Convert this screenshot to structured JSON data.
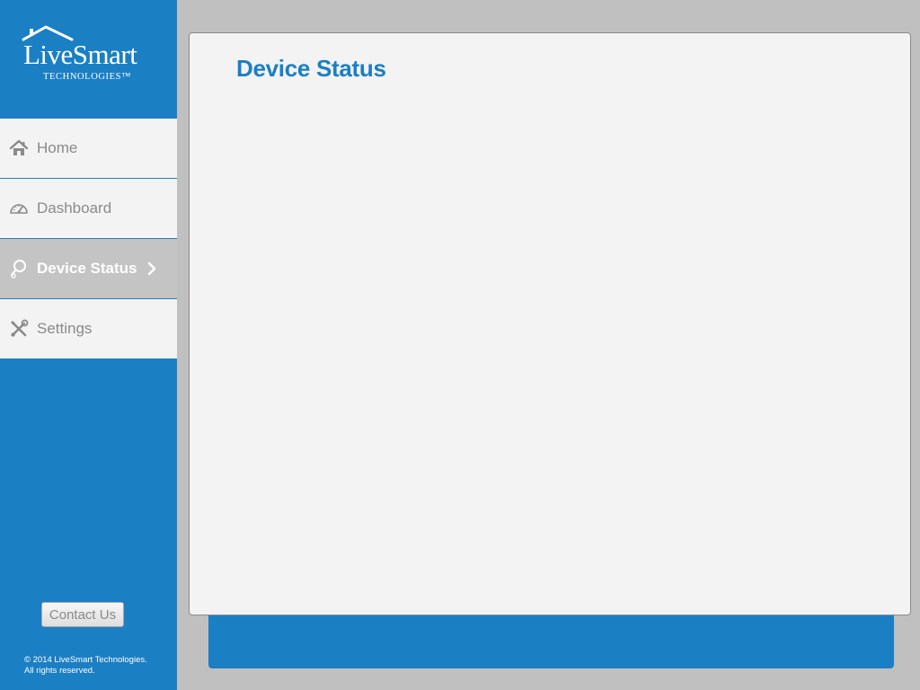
{
  "brand": {
    "name": "LiveSmart",
    "tagline": "TECHNOLOGIES™"
  },
  "nav": {
    "items": [
      {
        "label": "Home",
        "icon": "home-icon",
        "active": false
      },
      {
        "label": "Dashboard",
        "icon": "gauge-icon",
        "active": false
      },
      {
        "label": "Device Status",
        "icon": "search-icon",
        "active": true
      },
      {
        "label": "Settings",
        "icon": "tools-icon",
        "active": false
      }
    ]
  },
  "sidebar": {
    "contact_label": "Contact Us",
    "copyright_line1": "© 2014 LiveSmart Technologies.",
    "copyright_line2": "All rights reserved."
  },
  "main": {
    "title": "Device Status"
  },
  "colors": {
    "brand_blue": "#1b7fc4",
    "background": "#c0c0c0",
    "panel": "#f3f3f3",
    "nav_item": "#f3f3f3",
    "nav_active": "#c4c4c4",
    "nav_text": "#8a8a8a"
  }
}
